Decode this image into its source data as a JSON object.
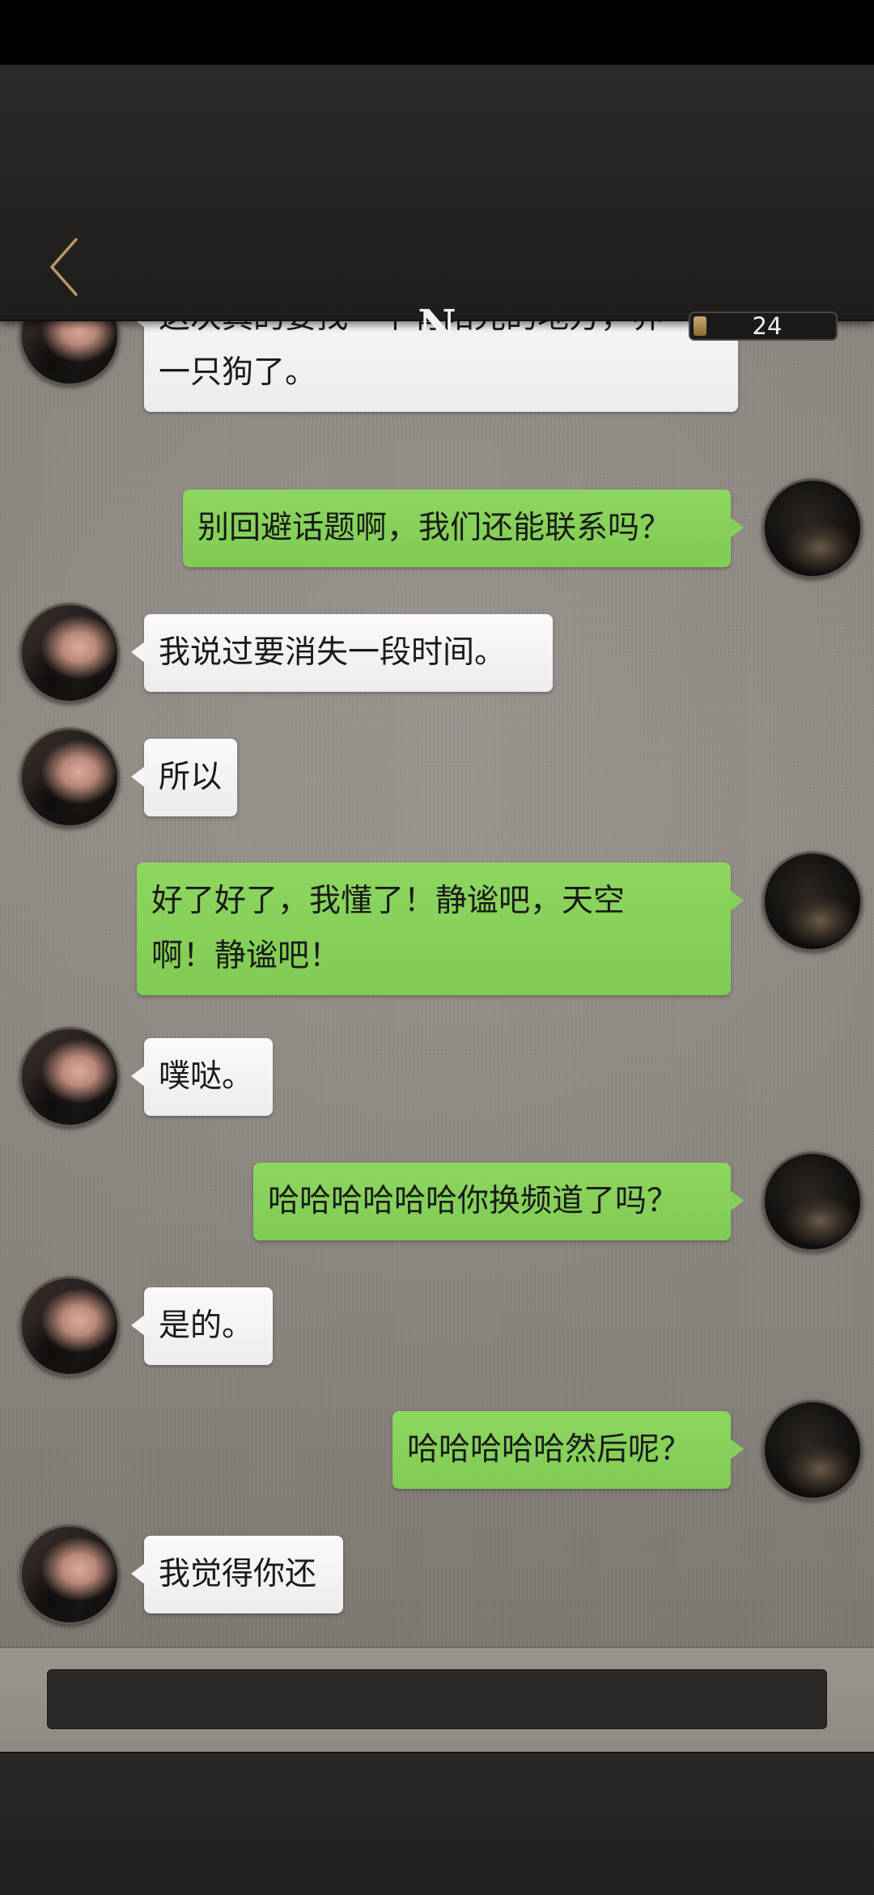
{
  "header": {
    "title": "N",
    "counter_value": "24",
    "back_icon": "chevron-left-icon",
    "accent_color": "#b99a63"
  },
  "messages": [
    {
      "side": "left",
      "text": "这次真的要找一个有阳光的地方，养\n一只狗了。"
    },
    {
      "side": "right",
      "text": "别回避话题啊，我们还能联系吗？"
    },
    {
      "side": "left",
      "text": "我说过要消失一段时间。"
    },
    {
      "side": "left",
      "text": "所以"
    },
    {
      "side": "right",
      "text": "好了好了，我懂了！静谧吧，天空\n啊！静谧吧！"
    },
    {
      "side": "left",
      "text": "噗哒。"
    },
    {
      "side": "right",
      "text": "哈哈哈哈哈哈你换频道了吗？"
    },
    {
      "side": "left",
      "text": "是的。"
    },
    {
      "side": "right",
      "text": "哈哈哈哈哈然后呢？"
    },
    {
      "side": "left",
      "text": "我觉得你还"
    }
  ],
  "input": {
    "value": ""
  },
  "colors": {
    "incoming_bubble": "#f5f5f5",
    "outgoing_bubble": "#86d05a",
    "background": "#8c8781"
  }
}
